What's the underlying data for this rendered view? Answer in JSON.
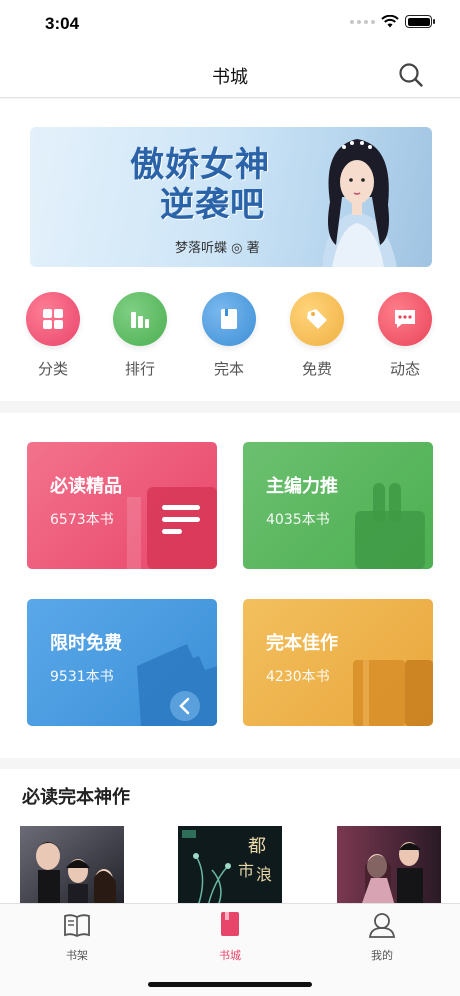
{
  "status_bar": {
    "time": "3:04"
  },
  "nav": {
    "title": "书城"
  },
  "banner": {
    "title_line1": "傲娇女神",
    "title_line2": "逆袭吧",
    "author": "梦落听蝶 ◎ 著"
  },
  "categories": [
    {
      "label": "分类",
      "icon": "grid-icon",
      "color": "#e8456a"
    },
    {
      "label": "排行",
      "icon": "bars-icon",
      "color": "#4caf50"
    },
    {
      "label": "完本",
      "icon": "book-icon",
      "color": "#3b8fd6"
    },
    {
      "label": "免费",
      "icon": "tag-icon",
      "color": "#f0b043"
    },
    {
      "label": "动态",
      "icon": "chat-icon",
      "color": "#e8456a"
    }
  ],
  "cards": [
    {
      "title": "必读精品",
      "count": "6573本书",
      "color": "#e8456a"
    },
    {
      "title": "主编力推",
      "count": "4035本书",
      "color": "#4caf50"
    },
    {
      "title": "限时免费",
      "count": "9531本书",
      "color": "#3b8fd6"
    },
    {
      "title": "完本佳作",
      "count": "4230本书",
      "color": "#eaa63c"
    }
  ],
  "featured": {
    "title": "必读完本神作"
  },
  "tabs": [
    {
      "label": "书架",
      "icon": "bookshelf-icon",
      "active": false
    },
    {
      "label": "书城",
      "icon": "bookstore-icon",
      "active": true
    },
    {
      "label": "我的",
      "icon": "profile-icon",
      "active": false
    }
  ]
}
